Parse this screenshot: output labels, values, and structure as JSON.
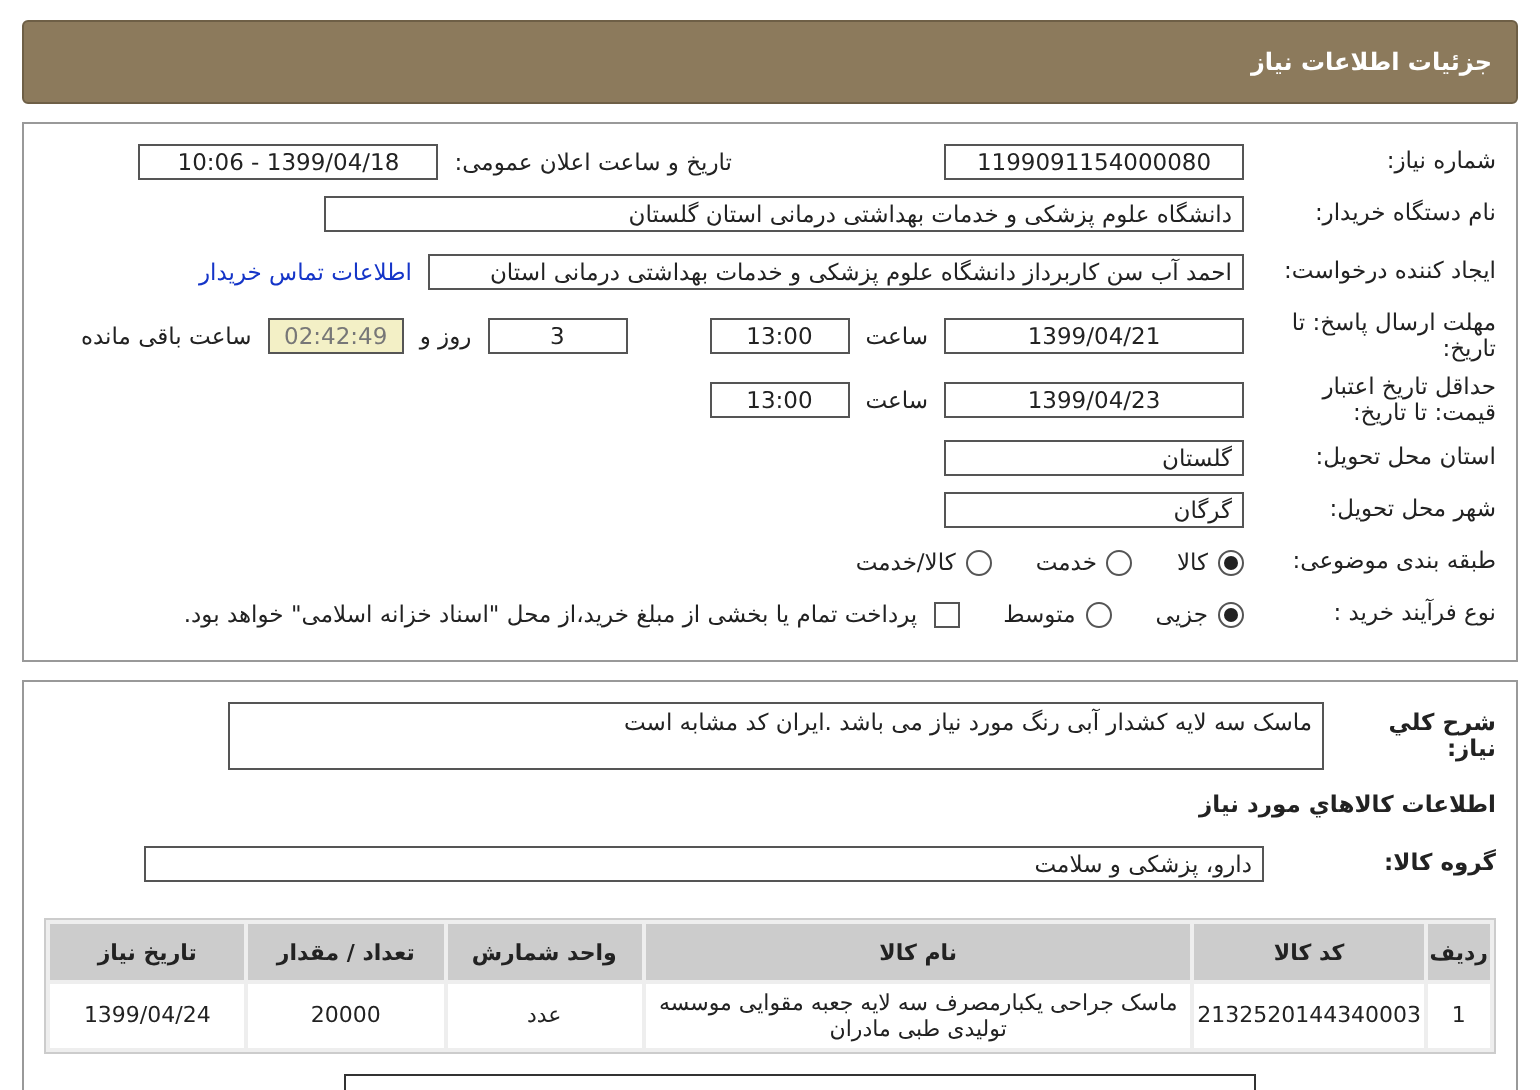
{
  "title": "جزئیات اطلاعات نیاز",
  "need_number": {
    "label": "شماره نیاز:",
    "value": "1199091154000080"
  },
  "announce": {
    "label": "تاریخ و ساعت اعلان عمومی:",
    "value": "1399/04/18 - 10:06"
  },
  "buyer": {
    "label": "نام دستگاه خریدار:",
    "value": "دانشگاه علوم پزشکی و خدمات بهداشتی درمانی استان گلستان"
  },
  "creator": {
    "label": "ایجاد کننده درخواست:",
    "value": "احمد آب سن کاربرداز دانشگاه علوم پزشکی و خدمات بهداشتی درمانی استان",
    "link": "اطلاعات تماس خریدار"
  },
  "deadline": {
    "label": "مهلت ارسال پاسخ: تا تاریخ:",
    "date": "1399/04/21",
    "time_label": "ساعت",
    "time": "13:00",
    "days": "3",
    "days_label": "روز و",
    "remaining": "02:42:49",
    "remaining_label": "ساعت باقی مانده"
  },
  "validity": {
    "label": "حداقل تاریخ اعتبار قیمت: تا تاریخ:",
    "date": "1399/04/23",
    "time_label": "ساعت",
    "time": "13:00"
  },
  "province": {
    "label": "استان محل تحویل:",
    "value": "گلستان"
  },
  "city": {
    "label": "شهر محل تحویل:",
    "value": "گرگان"
  },
  "category": {
    "label": "طبقه بندی موضوعی:",
    "options": [
      {
        "label": "کالا",
        "selected": true
      },
      {
        "label": "خدمت",
        "selected": false
      },
      {
        "label": "کالا/خدمت",
        "selected": false
      }
    ]
  },
  "process": {
    "label": "نوع فرآیند خرید :",
    "options": [
      {
        "label": "جزیی",
        "selected": true
      },
      {
        "label": "متوسط",
        "selected": false
      }
    ],
    "treasury": {
      "checked": false,
      "text": "پرداخت تمام یا بخشی از مبلغ خرید،از محل \"اسناد خزانه اسلامی\" خواهد بود."
    }
  },
  "description": {
    "label": "شرح کلي نیاز:",
    "value": "ماسک سه لایه کشدار آبی رنگ مورد نیاز می باشد .ایران کد مشابه است"
  },
  "goods_heading": "اطلاعات کالاهاي مورد نیاز",
  "goods_group": {
    "label": "گروه کالا:",
    "value": "دارو، پزشکی و سلامت"
  },
  "table": {
    "columns": [
      "ردیف",
      "کد کالا",
      "نام کالا",
      "واحد شمارش",
      "تعداد / مقدار",
      "تاریخ نیاز"
    ],
    "rows": [
      [
        "1",
        "2132520144340003",
        "ماسک جراحی یکبارمصرف سه لایه جعبه مقوایی موسسه تولیدی طبی مادران",
        "عدد",
        "20000",
        "1399/04/24"
      ]
    ]
  }
}
